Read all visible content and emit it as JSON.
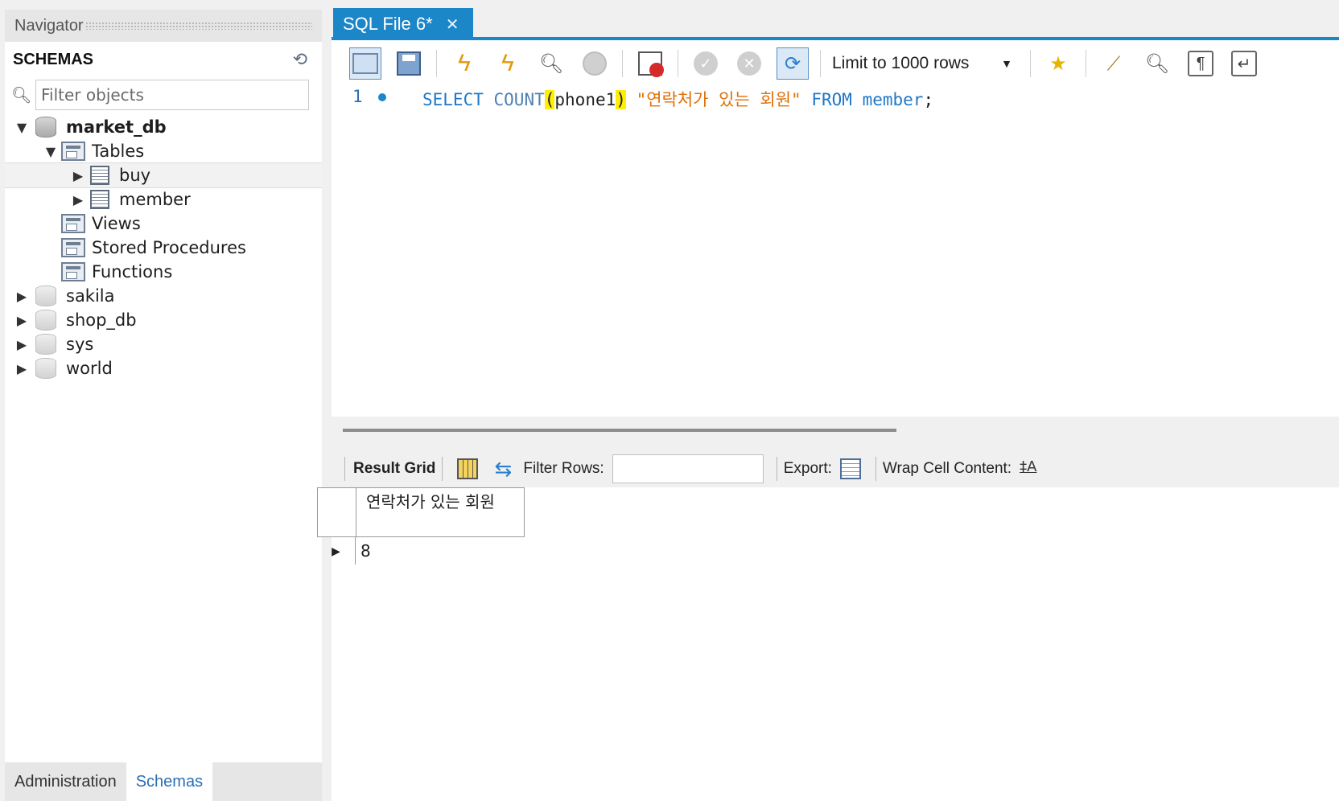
{
  "navigator": {
    "title": "Navigator",
    "schemas_label": "SCHEMAS",
    "filter_placeholder": "Filter objects",
    "tree": {
      "market_db": "market_db",
      "tables": "Tables",
      "buy": "buy",
      "member": "member",
      "views": "Views",
      "stored_procedures": "Stored Procedures",
      "functions": "Functions",
      "sakila": "sakila",
      "shop_db": "shop_db",
      "sys": "sys",
      "world": "world"
    },
    "tabs": [
      "Administration",
      "Schemas"
    ]
  },
  "editor": {
    "tab_title": "SQL File 6*",
    "limit_label": "Limit to 1000 rows",
    "line_number": "1",
    "code": {
      "select": "SELECT",
      "count": "COUNT",
      "open_paren": "(",
      "column": "phone1",
      "close_paren": ")",
      "alias": "\"연락처가 있는 회원\"",
      "from": "FROM",
      "table": "member",
      "semicolon": ";"
    }
  },
  "results": {
    "result_grid_label": "Result Grid",
    "filter_rows_label": "Filter Rows:",
    "export_label": "Export:",
    "wrap_label": "Wrap Cell Content:",
    "column_header": "연락처가 있는 회원",
    "rows": [
      "8"
    ]
  },
  "colors": {
    "accent": "#1b86c8",
    "keyword": "#1e78c8",
    "string": "#e07008",
    "bracket_highlight": "#ffee00"
  }
}
